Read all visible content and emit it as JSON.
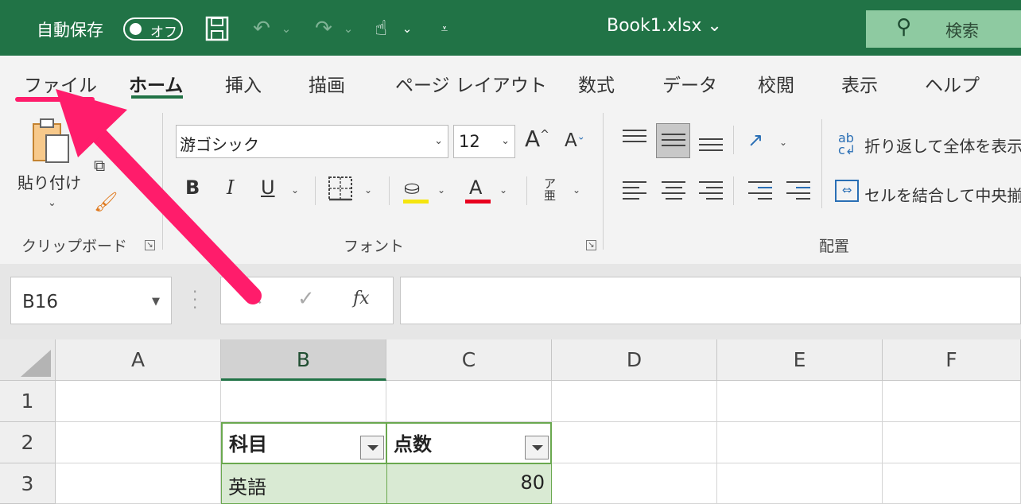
{
  "titlebar": {
    "autosave_label": "自動保存",
    "autosave_state": "オフ",
    "filename": "Book1.xlsx ⌄",
    "search_label": "検索"
  },
  "ribbon": {
    "tabs": [
      "ファイル",
      "ホーム",
      "挿入",
      "描画",
      "ページ レイアウト",
      "数式",
      "データ",
      "校閲",
      "表示",
      "ヘルプ"
    ],
    "active_tab": "ホーム",
    "clipboard": {
      "paste_label": "貼り付け",
      "group_label": "クリップボード"
    },
    "font": {
      "name": "游ゴシック",
      "size": "12",
      "group_label": "フォント"
    },
    "alignment": {
      "wrap_label": "折り返して全体を表示",
      "merge_label": "セルを結合して中央揃え",
      "group_label": "配置"
    }
  },
  "formula_bar": {
    "name_box": "B16",
    "formula": ""
  },
  "sheet": {
    "columns": [
      "A",
      "B",
      "C",
      "D",
      "E",
      "F"
    ],
    "rows": [
      "1",
      "2",
      "3"
    ],
    "header_cells": [
      "科目",
      "点数"
    ],
    "data": [
      {
        "subject": "英語",
        "score": "80"
      }
    ]
  },
  "colors": {
    "title_bar": "#217346",
    "table_fill": "#d9ead3",
    "table_border": "#6aa84f",
    "annotation_arrow": "#ff1c6b"
  }
}
